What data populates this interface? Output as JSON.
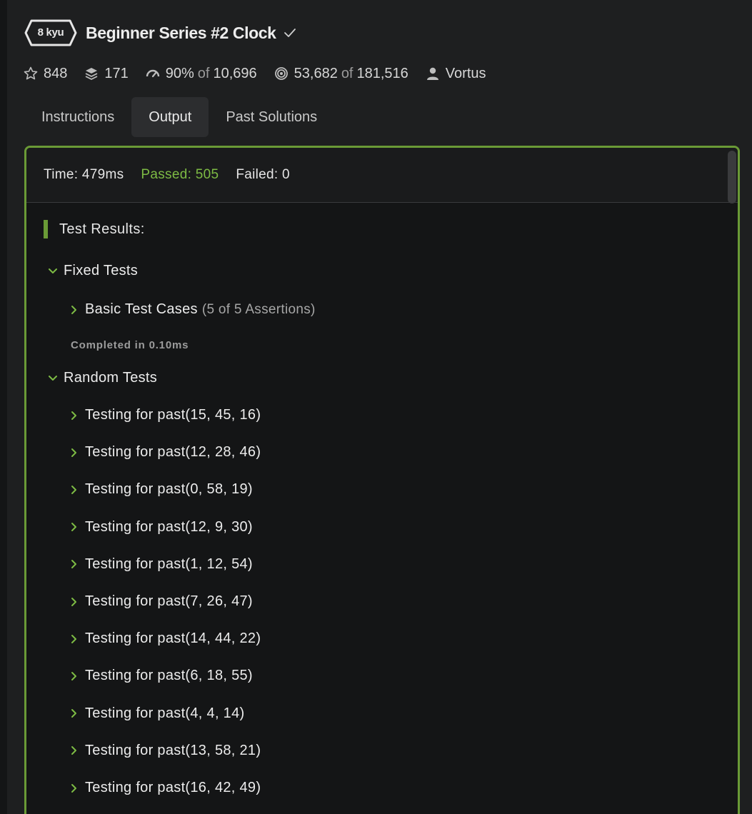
{
  "kata": {
    "rank": "8 kyu",
    "title": "Beginner Series #2 Clock"
  },
  "stats": {
    "stars": "848",
    "collections": "171",
    "satisfaction_pct": "90%",
    "satisfaction_of": "of",
    "satisfaction_total": "10,696",
    "completed": "53,682",
    "completed_of": "of",
    "attempted_total": "181,516",
    "author": "Vortus"
  },
  "tabs": [
    {
      "label": "Instructions"
    },
    {
      "label": "Output"
    },
    {
      "label": "Past Solutions"
    }
  ],
  "summary": {
    "time": "Time: 479ms",
    "passed": "Passed: 505",
    "failed": "Failed: 0"
  },
  "results": {
    "heading": "Test Results:",
    "fixed": {
      "label": "Fixed Tests",
      "basic_label": "Basic Test Cases",
      "basic_assertions": "(5 of 5 Assertions)",
      "completed": "Completed in 0.10ms"
    },
    "random": {
      "label": "Random Tests",
      "items": [
        "Testing for past(15, 45, 16)",
        "Testing for past(12, 28, 46)",
        "Testing for past(0, 58, 19)",
        "Testing for past(12, 9, 30)",
        "Testing for past(1, 12, 54)",
        "Testing for past(7, 26, 47)",
        "Testing for past(14, 44, 22)",
        "Testing for past(6, 18, 55)",
        "Testing for past(4, 4, 14)",
        "Testing for past(13, 58, 21)",
        "Testing for past(16, 42, 49)"
      ]
    }
  },
  "colors": {
    "accent_green": "#6a9a36",
    "passed_green": "#7dbb44",
    "background": "#1e1f20",
    "panel": "#141516"
  }
}
